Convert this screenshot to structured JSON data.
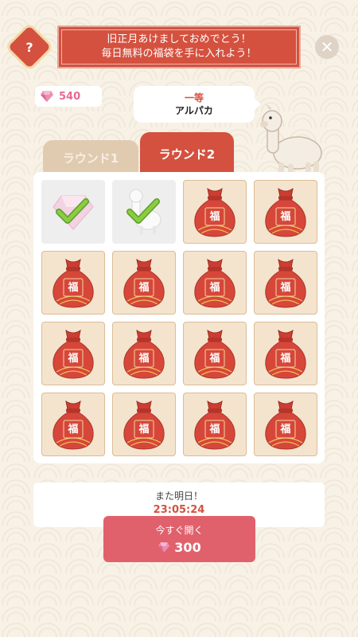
{
  "header": {
    "help_label": "?",
    "banner_line1": "旧正月あけましておめでとう！",
    "banner_line2": "毎日無料の福袋を手に入れよう！",
    "close_label": "✕"
  },
  "currency": {
    "gems": "540",
    "icon": "gem-icon"
  },
  "prize": {
    "rank": "一等",
    "name": "アルパカ"
  },
  "tabs": [
    {
      "label": "ラウンド1",
      "active": false
    },
    {
      "label": "ラウンド2",
      "active": true
    }
  ],
  "bags": {
    "char": "福",
    "cells": [
      "opened-gem",
      "opened-alpaca",
      "closed",
      "closed",
      "closed",
      "closed",
      "closed",
      "closed",
      "closed",
      "closed",
      "closed",
      "closed",
      "closed",
      "closed",
      "closed",
      "closed"
    ]
  },
  "footer": {
    "message": "また明日！",
    "timer": "23:05:24",
    "open_label": "今すぐ開く",
    "open_cost": "300"
  },
  "colors": {
    "accent": "#d4513f",
    "gem": "#e46b95",
    "button": "#e0616c",
    "cell": "#f4e4ce"
  }
}
